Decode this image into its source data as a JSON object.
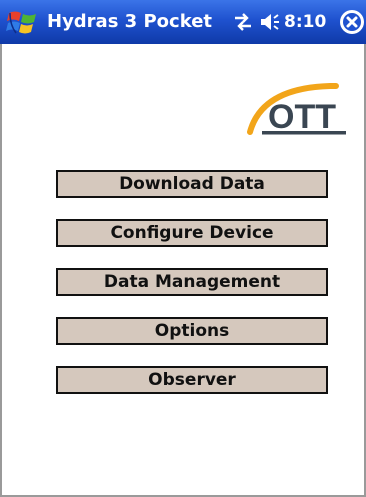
{
  "titlebar": {
    "app_title": "Hydras 3 Pocket",
    "clock": "8:10",
    "start_icon": "windows-flag-icon",
    "connectivity_icon": "connectivity-arrows-icon",
    "volume_icon": "speaker-icon",
    "close_icon": "close-icon",
    "colors": {
      "bar": "#1f52cf",
      "text": "#ffffff"
    }
  },
  "logo": {
    "text": "OTT",
    "colors": {
      "arc": "#f2a51a",
      "text": "#3a4652"
    }
  },
  "menu": {
    "buttons": [
      {
        "label": "Download Data"
      },
      {
        "label": "Configure Device"
      },
      {
        "label": "Data Management"
      },
      {
        "label": "Options"
      },
      {
        "label": "Observer"
      }
    ],
    "button_color": "#d5c8bd"
  }
}
